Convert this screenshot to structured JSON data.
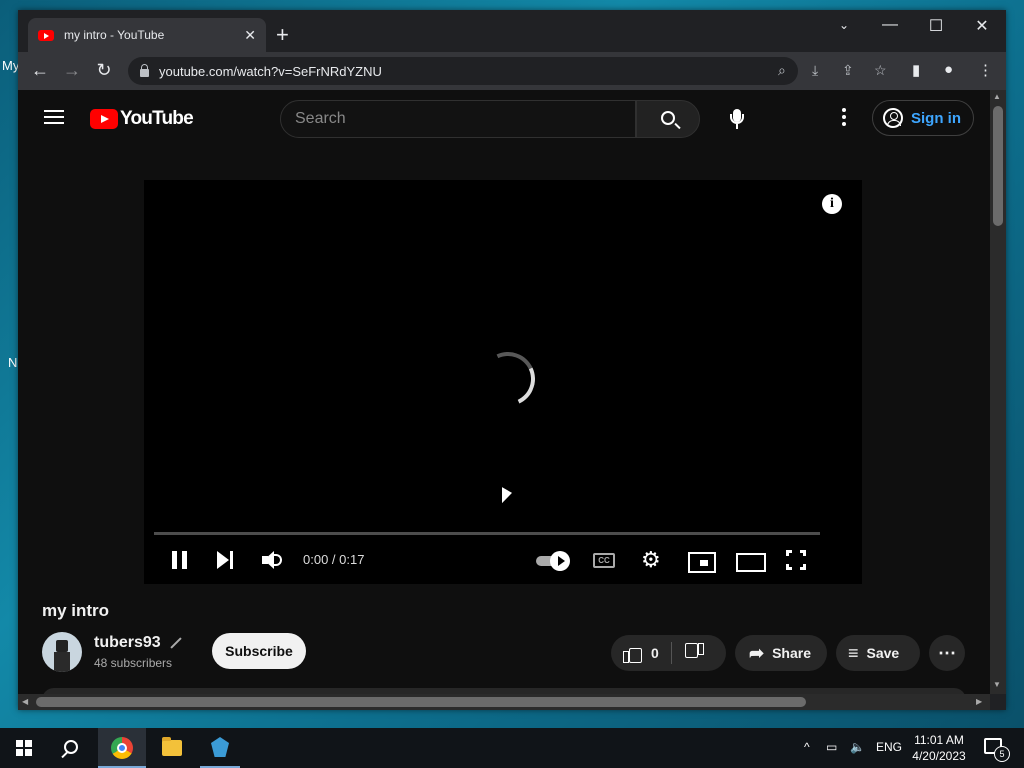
{
  "desktop": {
    "fragments": [
      "My",
      "N"
    ]
  },
  "browser": {
    "tab_title": "my intro - YouTube",
    "url": "youtube.com/watch?v=SeFrNRdYZNU"
  },
  "youtube": {
    "logo_text": "YouTube",
    "search_placeholder": "Search",
    "sign_in": "Sign in",
    "player": {
      "time": "0:00 / 0:17",
      "progress_fraction": 0,
      "autoplay_on": true
    },
    "video": {
      "title": "my intro",
      "channel": "tubers93",
      "subscribers": "48 subscribers",
      "subscribe_label": "Subscribe",
      "likes": "0",
      "share_label": "Share",
      "save_label": "Save"
    }
  },
  "taskbar": {
    "language": "ENG",
    "time": "11:01 AM",
    "date": "4/20/2023",
    "notifications": "5"
  }
}
